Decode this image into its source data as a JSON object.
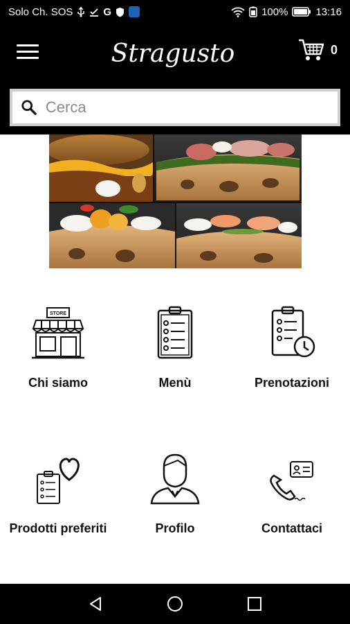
{
  "status_bar": {
    "carrier": "Solo Ch. SOS",
    "g_letter": "G",
    "battery": "100%",
    "time": "13:16"
  },
  "header": {
    "brand": "Stragusto",
    "cart_count": "0"
  },
  "search": {
    "placeholder": "Cerca"
  },
  "tiles": [
    {
      "label": "Chi siamo",
      "icon": "store-icon"
    },
    {
      "label": "Menù",
      "icon": "clipboard-checklist-icon"
    },
    {
      "label": "Prenotazioni",
      "icon": "clipboard-clock-icon"
    },
    {
      "label": "Prodotti preferiti",
      "icon": "clipboard-heart-icon"
    },
    {
      "label": "Profilo",
      "icon": "person-icon"
    },
    {
      "label": "Contattaci",
      "icon": "phone-contact-icon"
    }
  ],
  "store_sign": "STORE"
}
